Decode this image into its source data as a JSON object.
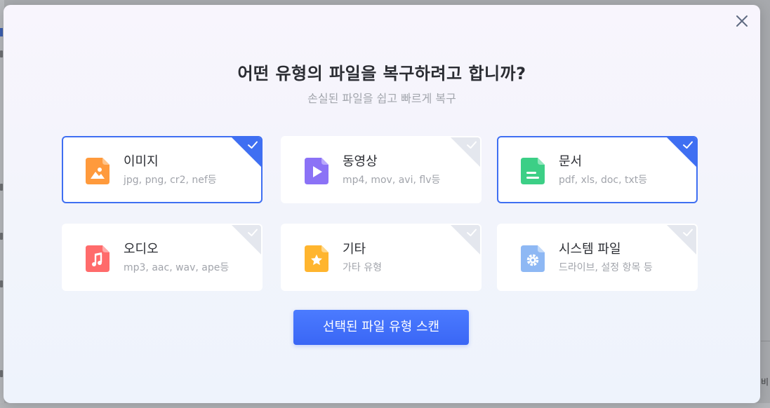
{
  "dialog": {
    "title": "어떤 유형의 파일을 복구하려고 합니까?",
    "subtitle": "손실된 파일을 쉽고 빠르게 복구",
    "scan_button_label": "선택된 파일 유형 스캔"
  },
  "file_types": [
    {
      "name": "이미지",
      "desc": "jpg, png, cr2, nef등",
      "selected": true,
      "icon": "image-file-icon",
      "color": "#ff9a3c"
    },
    {
      "name": "동영상",
      "desc": "mp4, mov, avi, flv등",
      "selected": false,
      "icon": "video-file-icon",
      "color": "#8b72f6"
    },
    {
      "name": "문서",
      "desc": "pdf, xls, doc, txt등",
      "selected": true,
      "icon": "document-file-icon",
      "color": "#3ccf86"
    },
    {
      "name": "오디오",
      "desc": "mp3, aac, wav, ape등",
      "selected": false,
      "icon": "audio-file-icon",
      "color": "#ff6b6b"
    },
    {
      "name": "기타",
      "desc": "가타 유형",
      "selected": false,
      "icon": "other-file-icon",
      "color": "#ffb52e"
    },
    {
      "name": "시스템 파일",
      "desc": "드라이브, 설정 항목 등",
      "selected": false,
      "icon": "system-file-icon",
      "color": "#8eb8f4"
    }
  ],
  "colors": {
    "accent": "#3f6ff2",
    "unselected_corner": "#e4e7ee"
  },
  "background": {
    "partial_text": "비"
  }
}
